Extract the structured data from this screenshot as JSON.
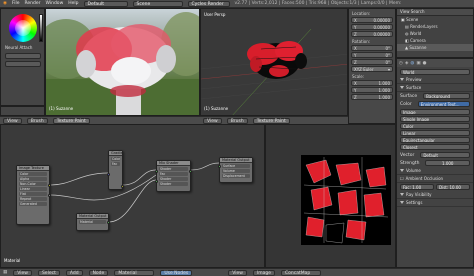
{
  "top_menu": {
    "items": [
      "File",
      "Render",
      "Window",
      "Help"
    ],
    "layout": "Default",
    "scene": "Scene",
    "engine": "Cycles Render",
    "stats": "v2.77 | Verts:2,012 | Faces:500 | Tris:968 | Objects:1/3 | Lamps:0/0 | Mem:"
  },
  "left_toolbar": {
    "label": "Neural Attach"
  },
  "viewport_left": {
    "corner_label": "(1) Suzanne",
    "header": {
      "items": [
        "View",
        "Brush",
        "Texture Paint"
      ]
    }
  },
  "viewport_right": {
    "title": "User Persp",
    "corner_label": "(1) Suzanne",
    "header": {
      "items": [
        "View",
        "Brush",
        "Texture Paint"
      ]
    }
  },
  "n_panel": {
    "location_label": "Location:",
    "location": [
      {
        "axis": "X",
        "value": "0.00000"
      },
      {
        "axis": "Y",
        "value": "0.00000"
      },
      {
        "axis": "Z",
        "value": "0.00000"
      }
    ],
    "rotation_label": "Rotation:",
    "rotation": [
      {
        "axis": "X",
        "value": "0°"
      },
      {
        "axis": "Y",
        "value": "0°"
      },
      {
        "axis": "Z",
        "value": "0°"
      }
    ],
    "rotation_mode": "XYZ Euler",
    "scale_label": "Scale:",
    "scale": [
      {
        "axis": "X",
        "value": "1.000"
      },
      {
        "axis": "Y",
        "value": "1.000"
      },
      {
        "axis": "Z",
        "value": "1.000"
      }
    ]
  },
  "outliner": {
    "header": "View Search",
    "items": [
      "Scene",
      "RenderLayers",
      "World",
      "Camera",
      "Suzanne"
    ]
  },
  "properties": {
    "world_name": "World",
    "sections": [
      "Preview",
      "Surface"
    ],
    "surface_label": "Surface",
    "surface_value": "Background",
    "color_label": "Color",
    "color_value": "Environment Text...",
    "image_name": "Image",
    "fields": [
      "Single Image",
      "Color",
      "Linear",
      "Equirectangular",
      "Closest"
    ],
    "vector_label": "Vector",
    "vector_value": "Default",
    "strength_label": "Strength",
    "strength_value": "1.000",
    "sections2": [
      "Volume",
      "Ambient Occlusion",
      "Ray Visibility",
      "Settings"
    ],
    "factor": "Fac: 1.00",
    "distance": "Dist: 10.00"
  },
  "node_editor": {
    "material_label": "Material",
    "header": {
      "items": [
        "View",
        "Select",
        "Add",
        "Node"
      ],
      "material": "Material",
      "use_nodes": "Use Nodes"
    },
    "nodes": {
      "image_texture": {
        "title": "Image Texture",
        "rows": [
          "Color",
          "Alpha",
          "Non-Color",
          "Linear",
          "Flat",
          "Repeat",
          "Generated"
        ]
      },
      "gradient": {
        "title": "Gradient Tex",
        "rows": [
          "Color",
          "Fac"
        ]
      },
      "mix": {
        "title": "Mix Shader",
        "rows": [
          "Shader",
          "Fac",
          "Shader",
          "Shader"
        ]
      },
      "output": {
        "title": "Material Output",
        "rows": [
          "Surface",
          "Volume",
          "Displacement"
        ]
      },
      "material_node": {
        "title": "Material Output",
        "rows": [
          "Material"
        ]
      }
    }
  },
  "uv_editor": {
    "header": {
      "items": [
        "View",
        "Image"
      ],
      "image": "New",
      "open": "Open"
    }
  },
  "timeline": {
    "items": [
      "View",
      "Select",
      "Add",
      "Node"
    ],
    "material": "Material",
    "use_nodes": "Use Nodes",
    "end": "ConcatMap"
  }
}
